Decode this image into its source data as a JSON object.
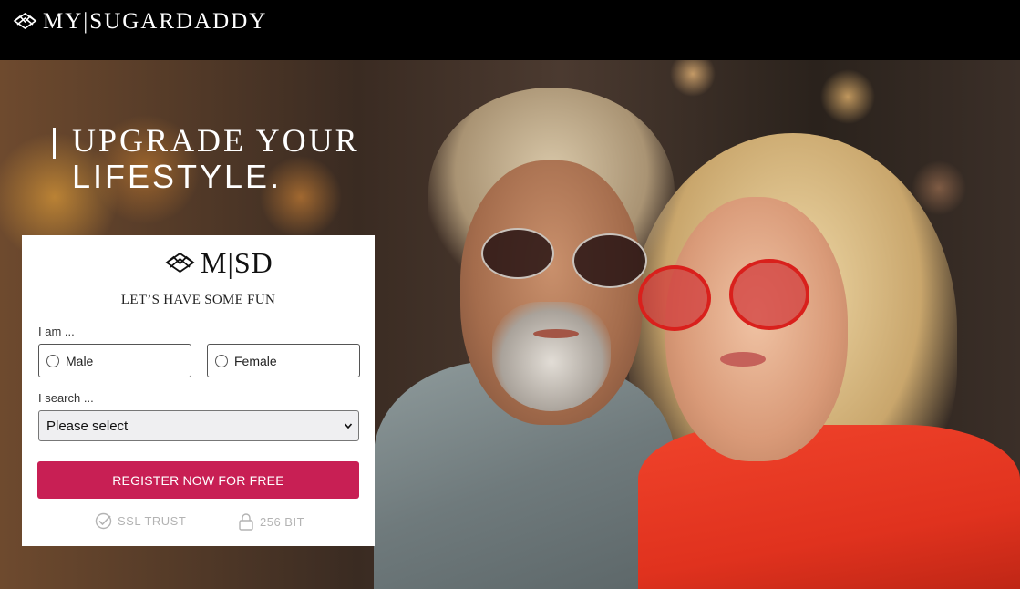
{
  "header": {
    "brand_name": "MY|SUGARDADDY",
    "logo_icon": "envelope-diamond-logo"
  },
  "hero": {
    "headline_line1": "UPGRADE YOUR",
    "headline_line2": "LIFESTYLE."
  },
  "signup_card": {
    "logo_text": "M|SD",
    "tagline": "LET’S HAVE SOME FUN",
    "iam_label": "I am ...",
    "gender_options": [
      "Male",
      "Female"
    ],
    "search_label": "I search ...",
    "search_select_value": "Please select",
    "cta_label": "REGISTER NOW FOR FREE",
    "trust_badges": [
      {
        "icon": "check-circle-icon",
        "label": "SSL TRUST"
      },
      {
        "icon": "lock-icon",
        "label": "256 BIT"
      }
    ]
  },
  "colors": {
    "topbar": "#000000",
    "cta": "#c81f54",
    "card": "#ffffff",
    "trust_text": "#b3b3b3"
  }
}
